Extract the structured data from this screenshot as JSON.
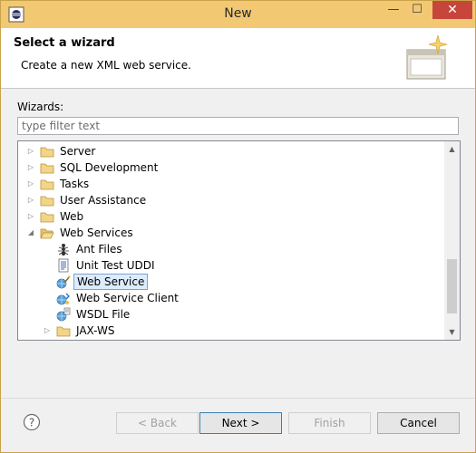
{
  "window": {
    "title": "New",
    "minimize": "—",
    "maximize": "☐",
    "close": "✕"
  },
  "header": {
    "title": "Select a wizard",
    "description": "Create a new XML web service."
  },
  "wizards_label": "Wizards:",
  "filter": {
    "placeholder": "type filter text",
    "value": ""
  },
  "tree": {
    "items": [
      {
        "label": "Server",
        "icon": "folder-icon",
        "twisty": "▷"
      },
      {
        "label": "SQL Development",
        "icon": "folder-icon",
        "twisty": "▷"
      },
      {
        "label": "Tasks",
        "icon": "folder-icon",
        "twisty": "▷"
      },
      {
        "label": "User Assistance",
        "icon": "folder-icon",
        "twisty": "▷"
      },
      {
        "label": "Web",
        "icon": "folder-icon",
        "twisty": "▷"
      },
      {
        "label": "Web Services",
        "icon": "folder-open-icon",
        "twisty": "◢"
      },
      {
        "label": "Ant Files",
        "icon": "ant-icon"
      },
      {
        "label": "Unit Test UDDI",
        "icon": "uddi-test-icon"
      },
      {
        "label": "Web Service",
        "icon": "web-service-icon",
        "selected": true
      },
      {
        "label": "Web Service Client",
        "icon": "web-service-client-icon"
      },
      {
        "label": "WSDL File",
        "icon": "wsdl-icon"
      },
      {
        "label": "JAX-WS",
        "icon": "folder-icon",
        "twisty": "▷"
      }
    ]
  },
  "buttons": {
    "back": "< Back",
    "next": "Next >",
    "finish": "Finish",
    "cancel": "Cancel"
  },
  "icons": {
    "help": "help-icon"
  },
  "colors": {
    "titlebar": "#f3c873",
    "close": "#c7463c",
    "selection": "#dcecfc"
  }
}
